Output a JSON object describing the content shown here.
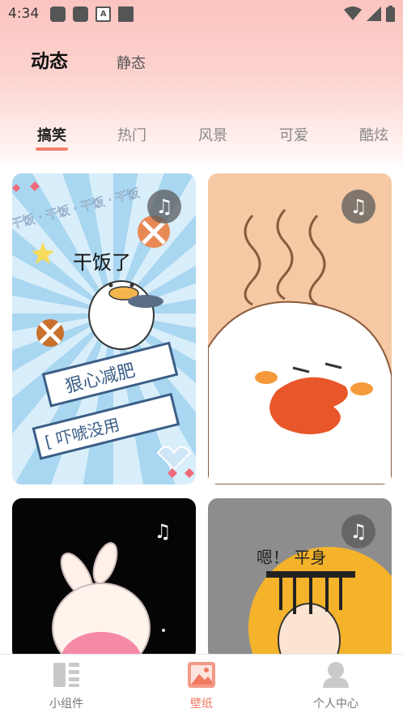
{
  "status_bar": {
    "time": "4:34",
    "a_badge": "A"
  },
  "mode_tabs": {
    "dynamic": "动态",
    "static": "静态"
  },
  "category_tabs": [
    "搞笑",
    "热门",
    "风景",
    "可爱",
    "酷炫"
  ],
  "cards": [
    {
      "text_top": "干饭了",
      "banner1": "狠心减肥",
      "banner2": "[ 吓唬没用",
      "scroll_text": "干饭 · 干饭 · 干饭 · 干饭",
      "music": "♫"
    },
    {
      "music": "♫"
    },
    {
      "music": "♫"
    },
    {
      "text": "嗯！ 平身",
      "music": "♫"
    }
  ],
  "bottom_nav": [
    {
      "label": "小组件",
      "icon": "widget-icon"
    },
    {
      "label": "壁纸",
      "icon": "wallpaper-icon"
    },
    {
      "label": "个人中心",
      "icon": "profile-icon"
    }
  ],
  "accent_color": "#f07a62"
}
